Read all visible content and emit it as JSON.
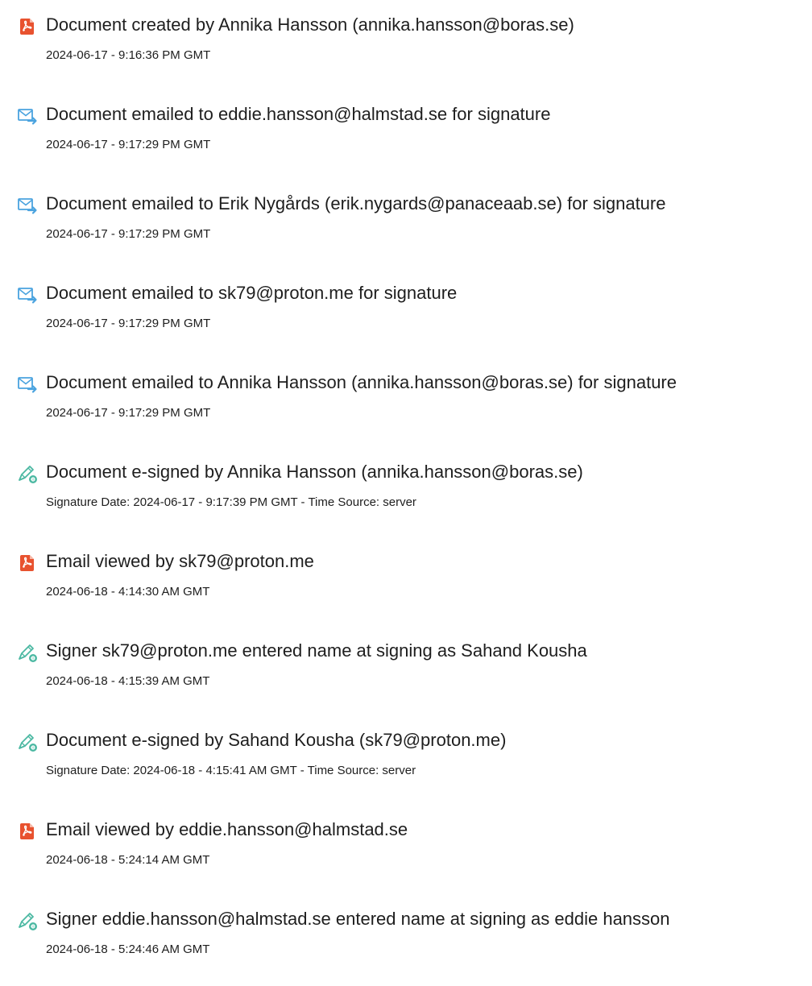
{
  "colors": {
    "created_icon": "#e8522f",
    "email_icon": "#4aa3df",
    "sign_icon": "#4bb8a2",
    "text": "#1e1e1e"
  },
  "entries": [
    {
      "icon": "document-icon",
      "title": "Document created by Annika Hansson (annika.hansson@boras.se)",
      "detail": "2024-06-17 - 9:16:36 PM GMT"
    },
    {
      "icon": "email-icon",
      "title": "Document emailed to eddie.hansson@halmstad.se for signature",
      "detail": "2024-06-17 - 9:17:29 PM GMT"
    },
    {
      "icon": "email-icon",
      "title": "Document emailed to Erik Nygårds (erik.nygards@panaceaab.se) for signature",
      "detail": "2024-06-17 - 9:17:29 PM GMT"
    },
    {
      "icon": "email-icon",
      "title": "Document emailed to sk79@proton.me for signature",
      "detail": "2024-06-17 - 9:17:29 PM GMT"
    },
    {
      "icon": "email-icon",
      "title": "Document emailed to Annika Hansson (annika.hansson@boras.se) for signature",
      "detail": "2024-06-17 - 9:17:29 PM GMT"
    },
    {
      "icon": "esign-icon",
      "title": "Document e-signed by Annika Hansson (annika.hansson@boras.se)",
      "detail": "Signature Date: 2024-06-17 - 9:17:39 PM GMT - Time Source: server"
    },
    {
      "icon": "document-icon",
      "title": "Email viewed by sk79@proton.me",
      "detail": "2024-06-18 - 4:14:30 AM GMT"
    },
    {
      "icon": "esign-icon",
      "title": "Signer sk79@proton.me entered name at signing as Sahand Kousha",
      "detail": "2024-06-18 - 4:15:39 AM GMT"
    },
    {
      "icon": "esign-icon",
      "title": "Document e-signed by Sahand Kousha (sk79@proton.me)",
      "detail": "Signature Date: 2024-06-18 - 4:15:41 AM GMT - Time Source: server"
    },
    {
      "icon": "document-icon",
      "title": "Email viewed by eddie.hansson@halmstad.se",
      "detail": "2024-06-18 - 5:24:14 AM GMT"
    },
    {
      "icon": "esign-icon",
      "title": "Signer eddie.hansson@halmstad.se entered name at signing as eddie hansson",
      "detail": "2024-06-18 - 5:24:46 AM GMT"
    }
  ]
}
